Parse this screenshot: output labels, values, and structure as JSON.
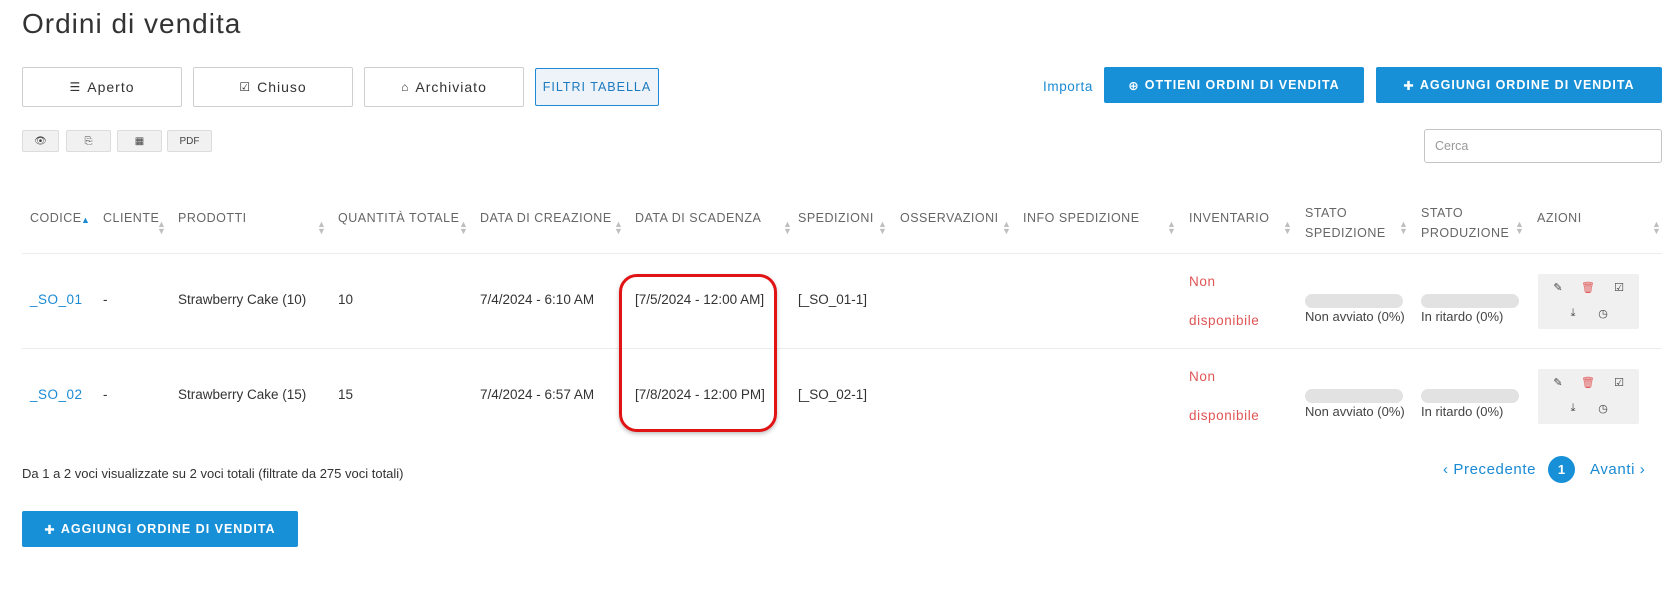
{
  "page": {
    "title": "Ordini di vendita"
  },
  "filters": [
    {
      "icon": "list-icon",
      "glyph": "☰",
      "label": "Aperto"
    },
    {
      "icon": "check-square-icon",
      "glyph": "☑",
      "label": "Chiuso"
    },
    {
      "icon": "inbox-icon",
      "glyph": "⌂",
      "label": "Archiviato"
    }
  ],
  "table_filters_label": "FILTRI TABELLA",
  "actions": {
    "import_label": "Importa",
    "get_orders_label": "OTTIENI ORDINI DI VENDITA",
    "add_order_label": "AGGIUNGI ORDINE DI VENDITA"
  },
  "tools": {
    "eye": "👁",
    "copy": "⎘",
    "table": "▦",
    "pdf": "PDF"
  },
  "search": {
    "placeholder": "Cerca",
    "value": ""
  },
  "table": {
    "columns": {
      "codice": "CODICE",
      "cliente": "CLIENTE",
      "prodotti": "PRODOTTI",
      "quantita": "QUANTITÀ TOTALE",
      "creazione": "DATA DI CREAZIONE",
      "scadenza": "DATA DI SCADENZA",
      "spedizioni": "SPEDIZIONI",
      "osservazioni": "OSSERVAZIONI",
      "info": "INFO SPEDIZIONE",
      "inventario": "INVENTARIO",
      "stato_sped_1": "STATO",
      "stato_sped_2": "SPEDIZIONE",
      "stato_prod_1": "STATO",
      "stato_prod_2": "PRODUZIONE",
      "azioni": "AZIONI"
    },
    "rows": [
      {
        "code": "_SO_01",
        "client": "-",
        "products": "Strawberry Cake (10)",
        "qty": "10",
        "created": "7/4/2024 - 6:10 AM",
        "due": "[7/5/2024 - 12:00 AM]",
        "shipments": "[_SO_01-1]",
        "inventory_1": "Non",
        "inventory_2": "disponibile",
        "ship_status": "Non avviato (0%)",
        "ship_progress": 0,
        "prod_status": "In ritardo (0%)",
        "prod_progress": 0
      },
      {
        "code": "_SO_02",
        "client": "-",
        "products": "Strawberry Cake (15)",
        "qty": "15",
        "created": "7/4/2024 - 6:57 AM",
        "due": "[7/8/2024 - 12:00 PM]",
        "shipments": "[_SO_02-1]",
        "inventory_1": "Non",
        "inventory_2": "disponibile",
        "ship_status": "Non avviato (0%)",
        "ship_progress": 0,
        "prod_status": "In ritardo (0%)",
        "prod_progress": 0
      }
    ]
  },
  "footer": {
    "summary": "Da 1 a 2 voci visualizzate su 2 voci totali (filtrate da 275 voci totali)",
    "prev_label": "‹ Precedente",
    "page": "1",
    "next_label": "Avanti ›"
  },
  "colors": {
    "accent": "#1890d8",
    "link": "#1a8ad4",
    "danger": "#e05555",
    "highlight": "#e01414"
  }
}
